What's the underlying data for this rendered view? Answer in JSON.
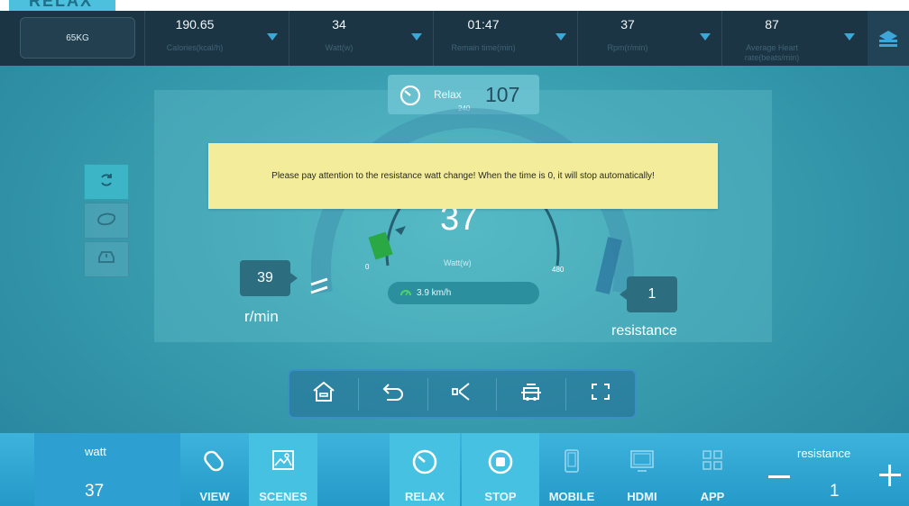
{
  "logo": {
    "text": "RELAX"
  },
  "topbar": {
    "weight": "65KG",
    "stats": [
      {
        "value": "190.65",
        "label": "Calories(kcal/h)"
      },
      {
        "value": "34",
        "label": "Watt(w)"
      },
      {
        "value": "01:47",
        "label": "Remain time(min)"
      },
      {
        "value": "37",
        "label": "Rpm(r/min)"
      },
      {
        "value": "87",
        "label": "Average Heart rate(beats/min)"
      }
    ],
    "menu_icon": "stack-icon"
  },
  "panel": {
    "mode_name": "Relax",
    "mode_value": "107",
    "gauge": {
      "tick_min": "0",
      "tick_mid": "240",
      "tick_max": "480",
      "value": "37",
      "unit": "Watt(w)",
      "pointer_fraction": 0.08
    },
    "speed": "3.9 km/h",
    "rpm": {
      "value": "39",
      "unit": "r/min"
    },
    "resistance": {
      "value": "1",
      "unit": "resistance"
    },
    "side_buttons": [
      "loop-icon",
      "bike-icon",
      "car-icon"
    ]
  },
  "toast": {
    "message": "Please pay attention to the resistance watt change! When the time is 0, it will stop automatically!"
  },
  "controls": [
    "home-icon",
    "back-icon",
    "volume-icon",
    "bus-icon",
    "fullscreen-icon"
  ],
  "bottom": {
    "watt_title": "watt",
    "watt_value": "37",
    "items": [
      {
        "label": "VIEW",
        "icon": "link-icon"
      },
      {
        "label": "SCENES",
        "icon": "picture-icon"
      },
      {
        "label": "RELAX",
        "icon": "speedometer-icon"
      },
      {
        "label": "STOP",
        "icon": "stop-icon"
      },
      {
        "label": "MOBILE",
        "icon": "phone-icon"
      },
      {
        "label": "HDMI",
        "icon": "monitor-icon"
      },
      {
        "label": "APP",
        "icon": "grid-icon"
      }
    ],
    "resistance_title": "resistance",
    "resistance_value": "1"
  },
  "colors": {
    "toast_bg": "#f3ed9b",
    "topbar_bg": "#1c3545",
    "bottombar_bg": "#3db3dc",
    "accent": "#3ea6d7"
  }
}
